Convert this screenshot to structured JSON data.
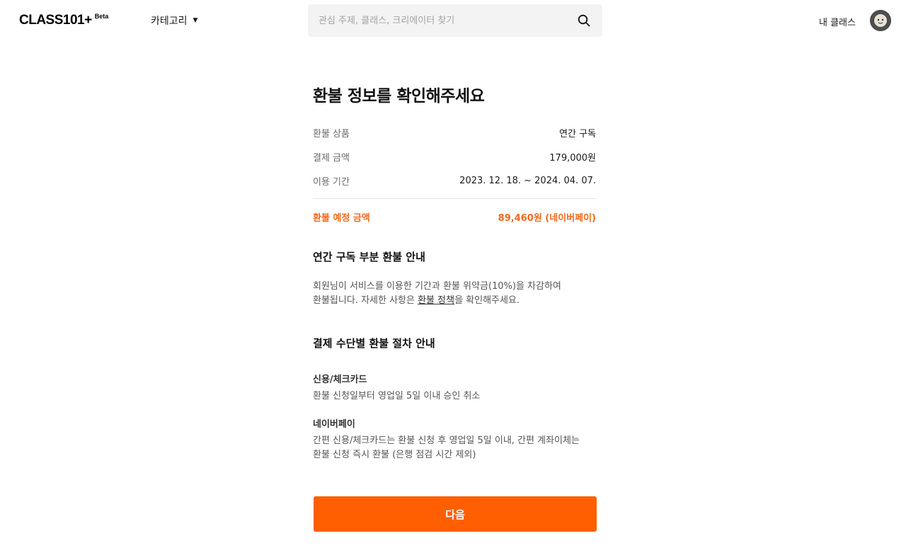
{
  "header": {
    "logo": "CLASS101+",
    "logo_badge": "Beta",
    "category_label": "카테고리",
    "search_placeholder": "관심 주제, 클래스, 크리에이터 찾기",
    "my_class_label": "내 클래스"
  },
  "main": {
    "title": "환불 정보를 확인해주세요",
    "rows": [
      {
        "label": "환불 상품",
        "value": "연간 구독"
      },
      {
        "label": "결제 금액",
        "value": "179,000원"
      },
      {
        "label": "이용 기간",
        "value": "2023. 12. 18. ~ 2024. 04. 07."
      }
    ],
    "refund": {
      "label": "환불 예정 금액",
      "value": "89,460원 (네이버페이)"
    },
    "partial_section": {
      "title": "연간 구독 부분 환불 안내",
      "line1": "회원님이 서비스를 이용한 기간과 환불 위약금(10%)을 차감하여",
      "line2_prefix": "환불됩니다. 자세한 사항은 ",
      "line2_link": "환불 정책",
      "line2_suffix": "을 확인해주세요."
    },
    "payment_section": {
      "title": "결제 수단별 환불 절차 안내",
      "methods": [
        {
          "name": "신용/체크카드",
          "lines": [
            "환불 신청일부터 영업일 5일 이내 승인 취소"
          ]
        },
        {
          "name": "네이버페이",
          "lines": [
            "간편 신용/체크카드는 환불 신청 후 영업일 5일 이내, 간편 계좌이체는",
            "환불 신청 즉시 환불 (은행 점검 시간 제외)"
          ]
        }
      ]
    },
    "next_button": "다음"
  },
  "colors": {
    "accent": "#ff5f00",
    "refund_text": "#f2691e"
  }
}
